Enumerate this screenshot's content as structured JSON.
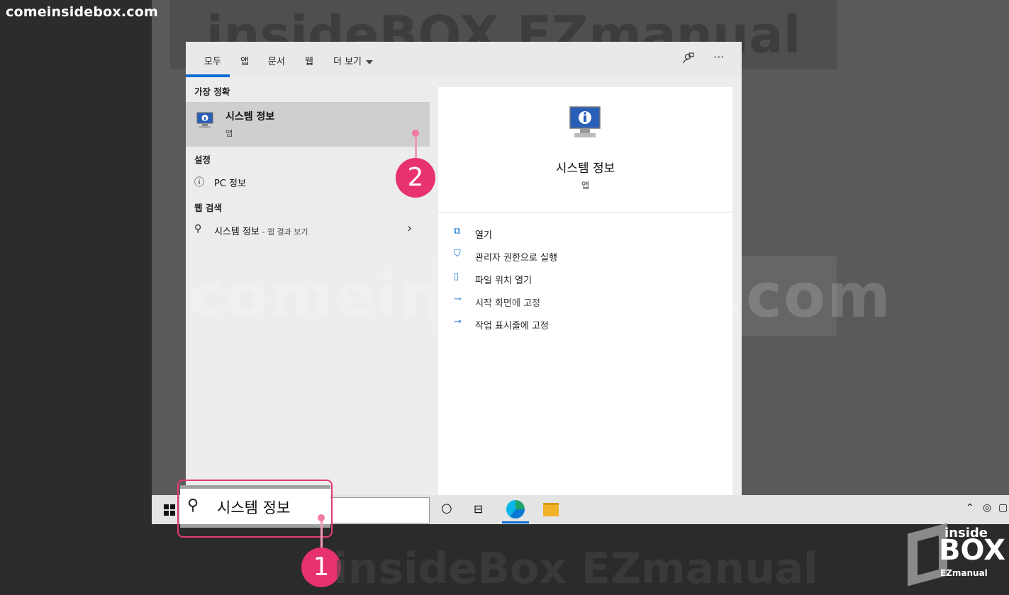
{
  "watermark": {
    "top": "comeinsidebox.com",
    "middle": "comeinsidebox.com",
    "title_overlay": "insideBOX EZmanual",
    "bottom": "insideBox EZmanual",
    "brand_small": "inside",
    "brand_big": "BOX",
    "brand_sub": "EZmanual"
  },
  "tabs": [
    {
      "label": "모두"
    },
    {
      "label": "앱"
    },
    {
      "label": "문서"
    },
    {
      "label": "웹"
    },
    {
      "label": "더 보기"
    }
  ],
  "sections": {
    "best_match": "가장 정확",
    "settings": "설정",
    "web_search": "웹 검색"
  },
  "best_result": {
    "name": "시스템 정보",
    "type": "앱"
  },
  "settings_item": {
    "label": "PC 정보"
  },
  "web_item": {
    "label": "시스템 정보",
    "suffix": " - 웹 결과 보기"
  },
  "preview": {
    "name": "시스템 정보",
    "type": "앱"
  },
  "actions": [
    {
      "label": "열기"
    },
    {
      "label": "관리자 권한으로 실행"
    },
    {
      "label": "파일 위치 열기"
    },
    {
      "label": "시작 화면에 고정"
    },
    {
      "label": "작업 표시줄에 고정"
    }
  ],
  "search": {
    "value": "시스템 정보"
  },
  "badges": {
    "one": "1",
    "two": "2"
  },
  "colors": {
    "accent": "#0a6cd4",
    "highlight": "#e8316f"
  }
}
